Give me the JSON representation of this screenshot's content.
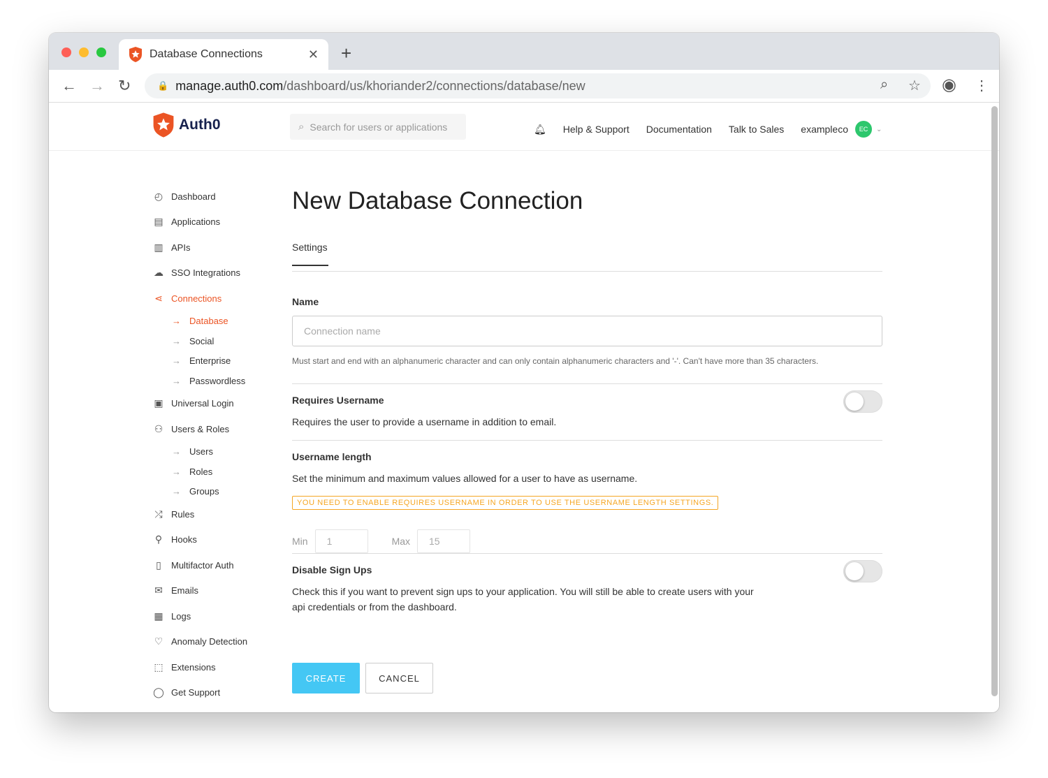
{
  "browser": {
    "tab_title": "Database Connections",
    "url_host": "manage.auth0.com",
    "url_path": "/dashboard/us/khoriander2/connections/database/new"
  },
  "header": {
    "brand": "Auth0",
    "search_placeholder": "Search for users or applications",
    "links": [
      "Help & Support",
      "Documentation",
      "Talk to Sales"
    ],
    "tenant": "exampleco",
    "avatar": "EC"
  },
  "sidebar": {
    "items": [
      {
        "label": "Dashboard",
        "icon": "dashboard-icon"
      },
      {
        "label": "Applications",
        "icon": "applications-icon"
      },
      {
        "label": "APIs",
        "icon": "apis-icon"
      },
      {
        "label": "SSO Integrations",
        "icon": "cloud-icon"
      },
      {
        "label": "Connections",
        "icon": "connections-icon",
        "active": true,
        "sub": [
          "Database",
          "Social",
          "Enterprise",
          "Passwordless"
        ]
      },
      {
        "label": "Universal Login",
        "icon": "login-icon"
      },
      {
        "label": "Users & Roles",
        "icon": "users-icon",
        "sub": [
          "Users",
          "Roles",
          "Groups"
        ]
      },
      {
        "label": "Rules",
        "icon": "rules-icon"
      },
      {
        "label": "Hooks",
        "icon": "hooks-icon"
      },
      {
        "label": "Multifactor Auth",
        "icon": "phone-icon"
      },
      {
        "label": "Emails",
        "icon": "mail-icon"
      },
      {
        "label": "Logs",
        "icon": "logs-icon"
      },
      {
        "label": "Anomaly Detection",
        "icon": "heart-icon"
      },
      {
        "label": "Extensions",
        "icon": "extensions-icon"
      },
      {
        "label": "Get Support",
        "icon": "chat-icon"
      }
    ]
  },
  "main": {
    "title": "New Database Connection",
    "tab": "Settings",
    "name_label": "Name",
    "name_placeholder": "Connection name",
    "name_help": "Must start and end with an alphanumeric character and can only contain alphanumeric characters and '-'. Can't have more than 35 characters.",
    "requires_username": {
      "label": "Requires Username",
      "desc": "Requires the user to provide a username in addition to email.",
      "on": false
    },
    "username_length": {
      "label": "Username length",
      "desc": "Set the minimum and maximum values allowed for a user to have as username.",
      "warning": "YOU NEED TO ENABLE REQUIRES USERNAME IN ORDER TO USE THE USERNAME LENGTH SETTINGS.",
      "min_label": "Min",
      "min": "1",
      "max_label": "Max",
      "max": "15"
    },
    "disable_signups": {
      "label": "Disable Sign Ups",
      "desc": "Check this if you want to prevent sign ups to your application. You will still be able to create users with your api credentials or from the dashboard.",
      "on": false
    },
    "create": "CREATE",
    "cancel": "CANCEL"
  },
  "colors": {
    "accent": "#eb5424",
    "create": "#44c7f4",
    "warning": "#f5a623"
  }
}
